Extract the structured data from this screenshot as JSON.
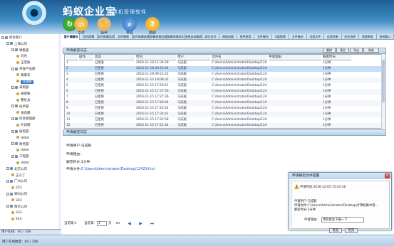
{
  "header": {
    "brand": "蚂蚁企业宝",
    "subtitle": "计算机管理软件"
  },
  "toolbar": {
    "file": "文件",
    "ops": "操作",
    "query": "查看",
    "help": "帮助"
  },
  "tabs": [
    "客户端概况",
    "实时屏幕",
    "实时屏幕监控",
    "实时摄像",
    "实时屏幕录像",
    "屏幕录像回放",
    "屏幕录像导出",
    "违规自动截屏",
    "网址访问",
    "网络流量",
    "程序使用",
    "文件操作",
    "U盘管理",
    "文件备份",
    "远程文件",
    "远程控制",
    "历史消息",
    "违规审批",
    "进程窗口"
  ],
  "sidebar": {
    "tree": [
      {
        "label": "所有客户",
        "level": 0,
        "icon": "computer",
        "toggle": "-"
      },
      {
        "label": "上海公司",
        "level": 1,
        "icon": "group",
        "toggle": "-"
      },
      {
        "label": "销售部",
        "level": 2,
        "icon": "group",
        "toggle": "-"
      },
      {
        "label": "刘光",
        "level": 3,
        "icon": "user"
      },
      {
        "label": "王宏振",
        "level": 3,
        "icon": "user"
      },
      {
        "label": "开发产品部",
        "level": 2,
        "icon": "group",
        "toggle": "-"
      },
      {
        "label": "黄家军",
        "level": 3,
        "icon": "user"
      },
      {
        "label": "马成毅",
        "level": 3,
        "icon": "user",
        "selected": true
      },
      {
        "label": "采购部",
        "level": 2,
        "icon": "group",
        "toggle": "-"
      },
      {
        "label": "徐晓晖",
        "level": 3,
        "icon": "user"
      },
      {
        "label": "曹伦兵",
        "level": 3,
        "icon": "user"
      },
      {
        "label": "技术部",
        "level": 2,
        "icon": "group",
        "toggle": "-"
      },
      {
        "label": "张志鹏",
        "level": 3,
        "icon": "user"
      },
      {
        "label": "综合管理部",
        "level": 2,
        "icon": "group",
        "toggle": "-"
      },
      {
        "label": "叶润楷",
        "level": 3,
        "icon": "user"
      },
      {
        "label": "质检部",
        "level": 2,
        "icon": "group",
        "toggle": "-"
      },
      {
        "label": "dddd",
        "level": 3,
        "icon": "user"
      },
      {
        "label": "财务部",
        "level": 2,
        "icon": "group",
        "toggle": "-"
      },
      {
        "label": "dddd",
        "level": 3,
        "icon": "user"
      },
      {
        "label": "工程部",
        "level": 2,
        "icon": "group",
        "toggle": "-"
      },
      {
        "label": "dddd",
        "level": 3,
        "icon": "user"
      },
      {
        "label": "北京公司",
        "level": 1,
        "icon": "group",
        "toggle": "-"
      },
      {
        "label": "王小丁",
        "level": 2,
        "icon": "user"
      },
      {
        "label": "广州公司",
        "level": 1,
        "icon": "group",
        "toggle": "-"
      },
      {
        "label": "222",
        "level": 2,
        "icon": "user"
      },
      {
        "label": "郑州公司",
        "level": 1,
        "icon": "group",
        "toggle": "-"
      },
      {
        "label": "333",
        "level": 2,
        "icon": "user"
      },
      {
        "label": "南京公司",
        "level": 1,
        "icon": "group",
        "toggle": "-"
      },
      {
        "label": "333",
        "level": 2,
        "icon": "user"
      },
      {
        "label": "444",
        "level": 2,
        "icon": "user"
      }
    ],
    "footer": "用户在线：60 / 108"
  },
  "list_panel": {
    "title": "申请解密日志",
    "actions": [
      "删除",
      "清空",
      "导出",
      "刷新"
    ],
    "columns": [
      "",
      "操作",
      "状态",
      "时间",
      "用户",
      "文件名",
      "申请理由",
      "解密时长"
    ],
    "rows": [
      {
        "n": "1",
        "status": "已批准",
        "time": "2016-11-18 11:34:28",
        "user": "马成毅",
        "file": "C:\\Users\\Administrator\\Desktop\\124",
        "dur": "1分钟"
      },
      {
        "n": "2",
        "status": "已拒绝",
        "time": "2016-11-18 09:24:04",
        "user": "马成毅",
        "file": "C:\\Users\\Administrator\\Desktop\\124",
        "dur": "1分钟"
      },
      {
        "n": "3",
        "status": "已拒绝",
        "time": "2016-11-18 09:22:22",
        "user": "马成毅",
        "file": "C:\\Users\\Administrator\\Desktop\\124",
        "dur": "1分钟"
      },
      {
        "n": "4",
        "status": "已拒绝",
        "time": "2016-11-15 18:08:32",
        "user": "马成毅",
        "file": "C:\\Users\\Administrator\\Desktop\\124",
        "dur": "1分钟"
      },
      {
        "n": "5",
        "status": "已拒绝",
        "time": "2016-11-15 17:59:21",
        "user": "马成毅",
        "file": "C:\\Users\\Administrator\\Desktop\\124",
        "dur": "1分钟"
      },
      {
        "n": "6",
        "status": "已拒绝",
        "time": "2016-11-15 17:27:56",
        "user": "马成毅",
        "file": "C:\\Users\\Administrator\\Desktop\\124",
        "dur": "1分钟"
      },
      {
        "n": "7",
        "status": "已拒绝",
        "time": "2016-11-15 17:27:36",
        "user": "马成毅",
        "file": "C:\\Users\\Administrator\\Desktop\\124",
        "dur": "1分钟"
      },
      {
        "n": "8",
        "status": "已拒绝",
        "time": "2016-11-15 17:26:04",
        "user": "马成毅",
        "file": "C:\\Users\\Administrator\\Desktop\\124",
        "dur": "1分钟"
      },
      {
        "n": "9",
        "status": "已拒绝",
        "time": "2016-11-15 17:25:24",
        "user": "马成毅",
        "file": "C:\\Users\\Administrator\\Desktop\\124",
        "dur": "1分钟"
      },
      {
        "n": "10",
        "status": "已拒绝",
        "time": "2016-11-15 17:24:41",
        "user": "马成毅",
        "file": "C:\\Users\\Administrator\\Desktop\\124",
        "dur": "1分钟"
      },
      {
        "n": "11",
        "status": "已拒绝",
        "time": "2016-11-15 17:22:58",
        "user": "马成毅",
        "file": "C:\\Users\\Administrator\\Desktop\\124",
        "dur": "1分钟"
      },
      {
        "n": "12",
        "status": "已拒绝",
        "time": "2016-11-15 17:21:44",
        "user": "马成毅",
        "file": "C:\\Users\\Administrator\\Desktop\\124",
        "dur": "1分钟"
      }
    ]
  },
  "detail_panel": {
    "title": "申请解密日志",
    "applicant": "申请用户:马成毅",
    "reason": "申请理由:",
    "duration": "解密时长:1分钟",
    "file_label": "申请文件:",
    "file_path": "C:\\Users\\Administrator\\Desktop\\124214.txt"
  },
  "pager": {
    "label": "当前第:1",
    "page_label": "当前第:",
    "page_value": "1",
    "suffix": "页"
  },
  "status": {
    "text": "用户在线数量：60 / 108"
  },
  "notify": {
    "title": "申请解密文件提醒",
    "close": "×",
    "time": "申请时间:2016-12-05 15:43:16",
    "user": "申请用户:马成毅",
    "file": "申请文件:C:\\Users\\Administrator\\Desktop\\计算机集中管...",
    "duration": "解密时长:3分钟",
    "reason_label": "申请理由:",
    "reason_value": "请您批准下载一下",
    "approve": "批准",
    "reject": "拒绝"
  },
  "colors": {
    "accent": "#3d78c2",
    "header": "#2e77b5",
    "brand_text": "#ffffff"
  }
}
